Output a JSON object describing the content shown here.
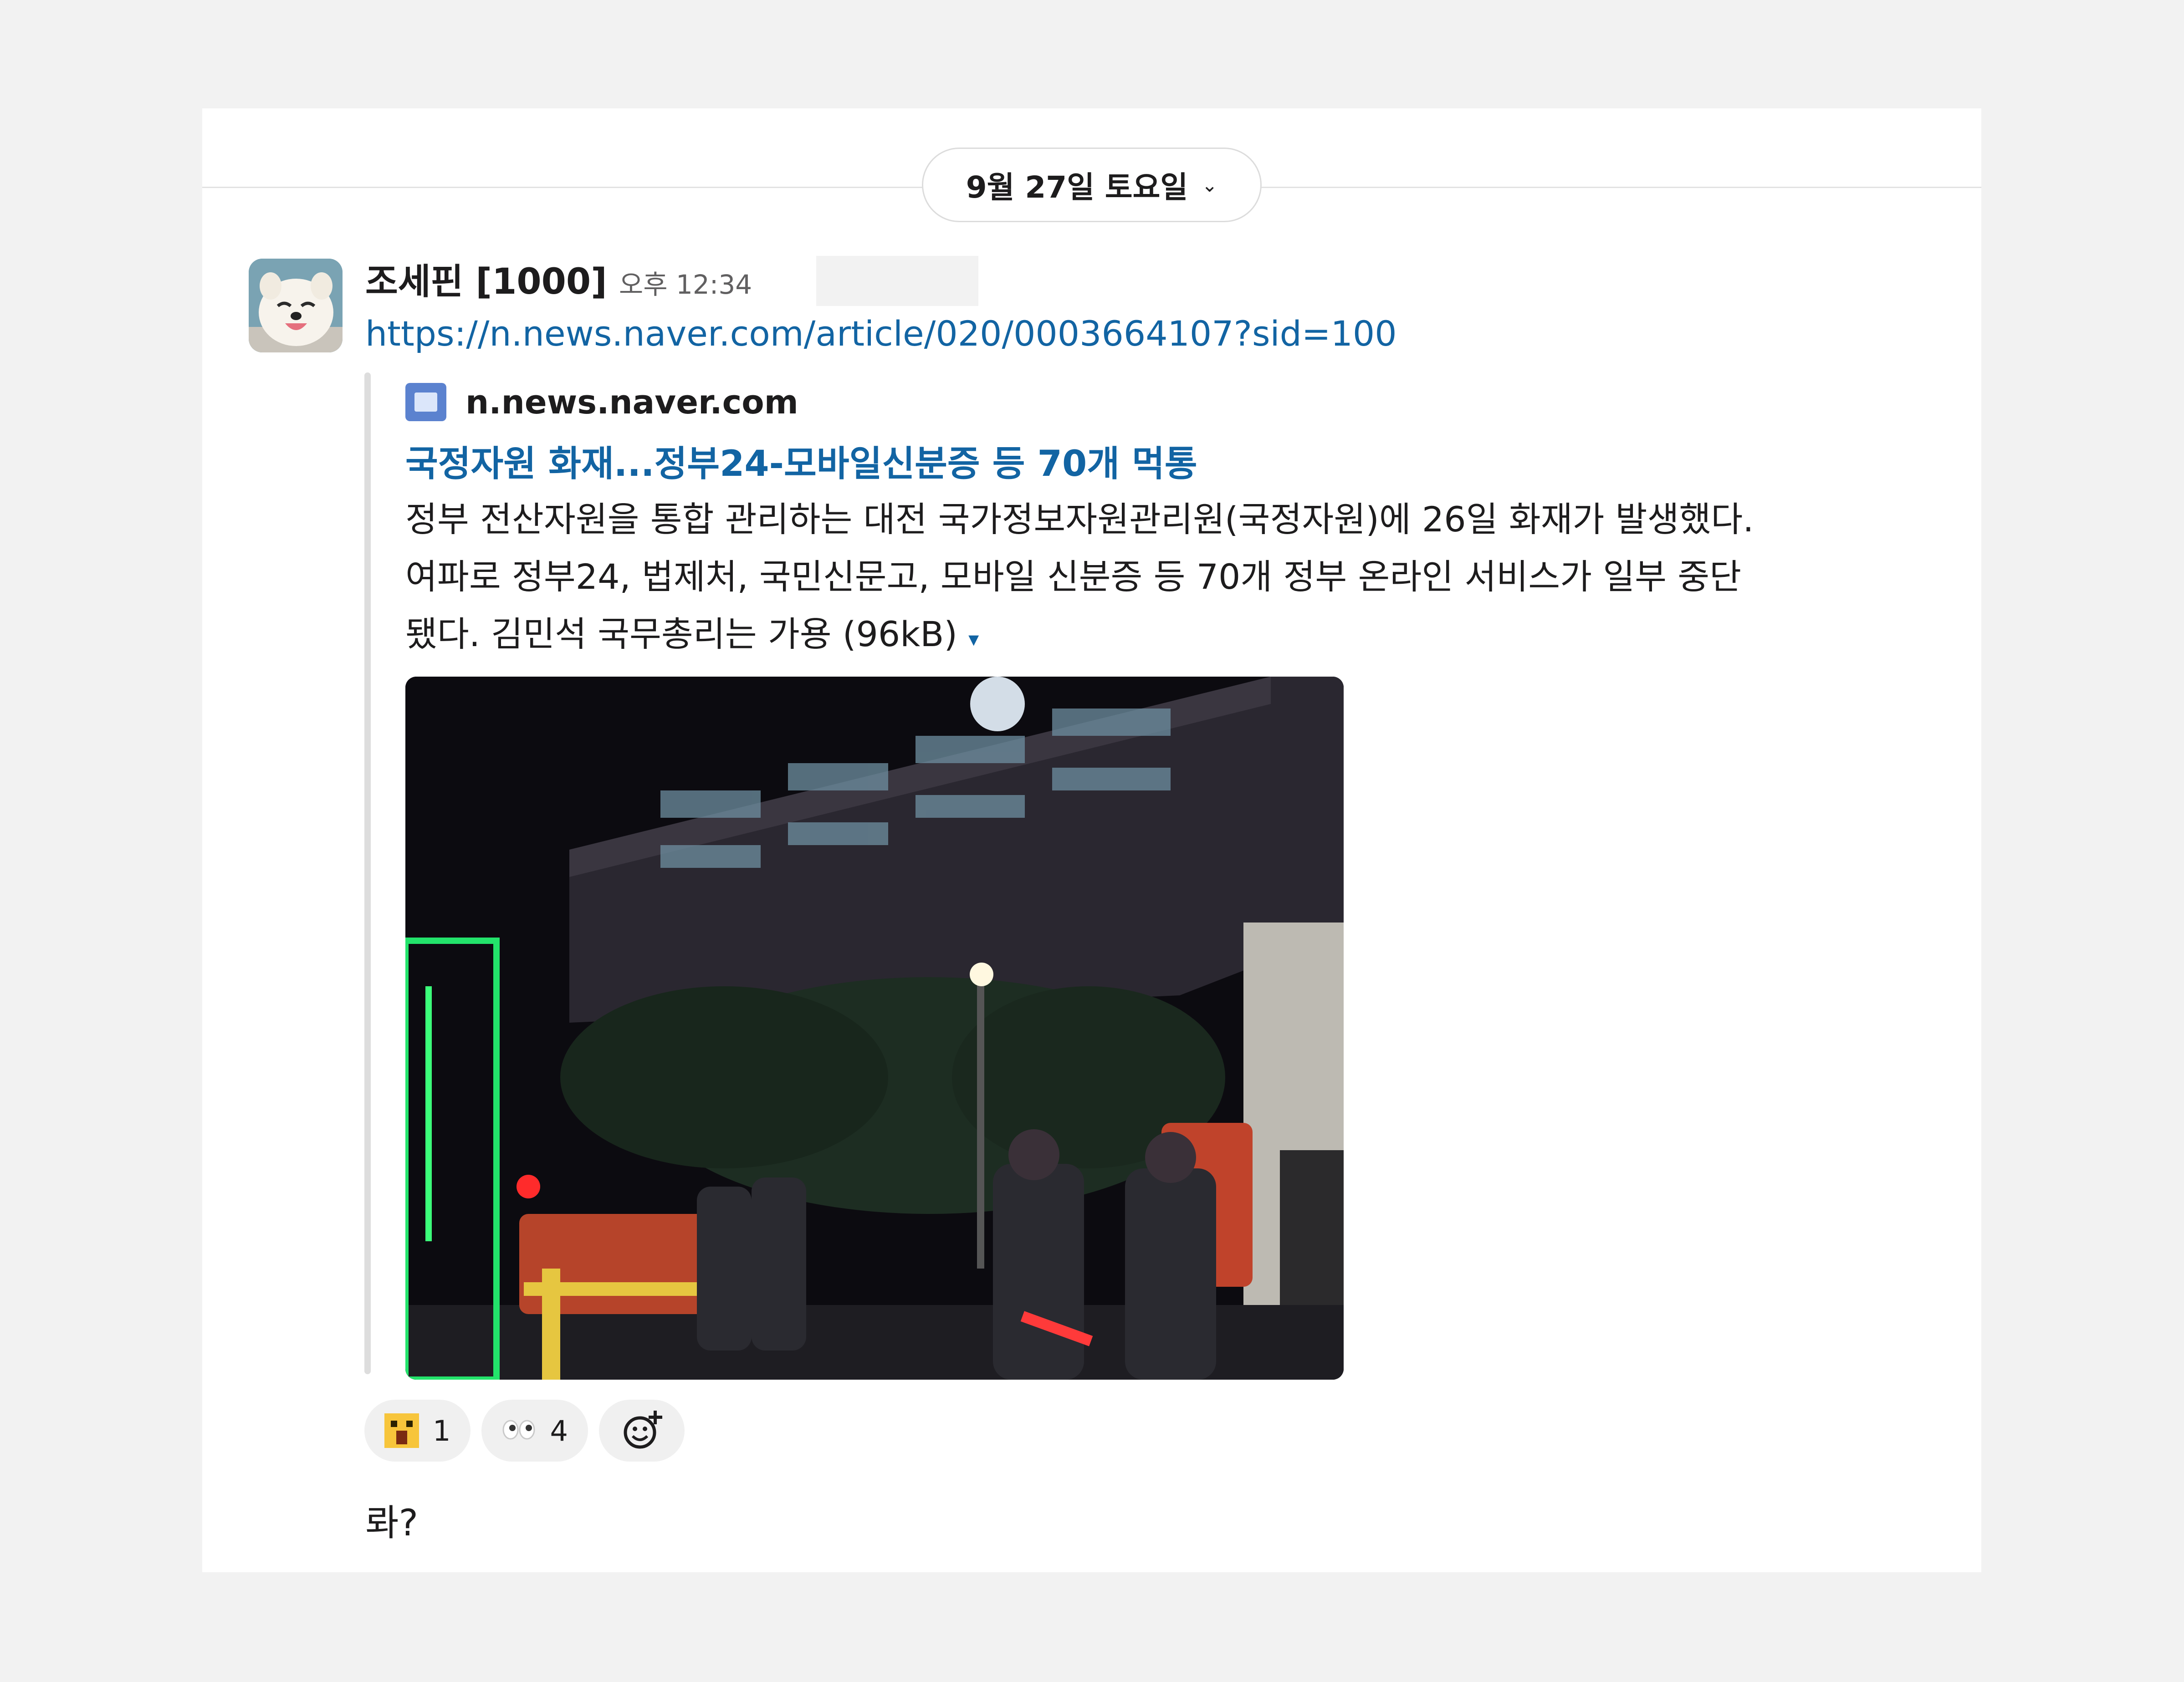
{
  "date_divider": {
    "label": "9월 27일 토요일",
    "chevron": "⌄"
  },
  "message": {
    "sender": "조세핀 [1000]",
    "time": "오후 12:34",
    "link": "https://n.news.naver.com/article/020/0003664107?sid=100",
    "avatar_icon": "white-dog-avatar"
  },
  "unfurl": {
    "site_icon": "document-icon",
    "site": "n.news.naver.com",
    "title": "국정자원 화재...정부24-모바일신분증 등 70개 먹통",
    "description": "정부 전산자원을 통합 관리하는 대전 국가정보자원관리원(국정자원)에 26일 화재가 발생했다.\n여파로 정부24, 법제처, 국민신문고, 모바일 신분증 등 70개 정부 온라인 서비스가 일부 중단\n됐다. 김민석 국무총리는 가용 (96kB)",
    "caret": "▾",
    "image_icon": "news-photo-night-fire-scene"
  },
  "reactions": [
    {
      "emoji_icon": "screaming-face-emoji",
      "count": "1"
    },
    {
      "emoji_icon": "eyes-emoji",
      "count": "4"
    }
  ],
  "add_reaction_icon": "add-reaction-icon",
  "followup_text": "롸?",
  "colors": {
    "link": "#1264a3",
    "background": "#f2f2f2",
    "pill_border": "#dcdcdc"
  }
}
